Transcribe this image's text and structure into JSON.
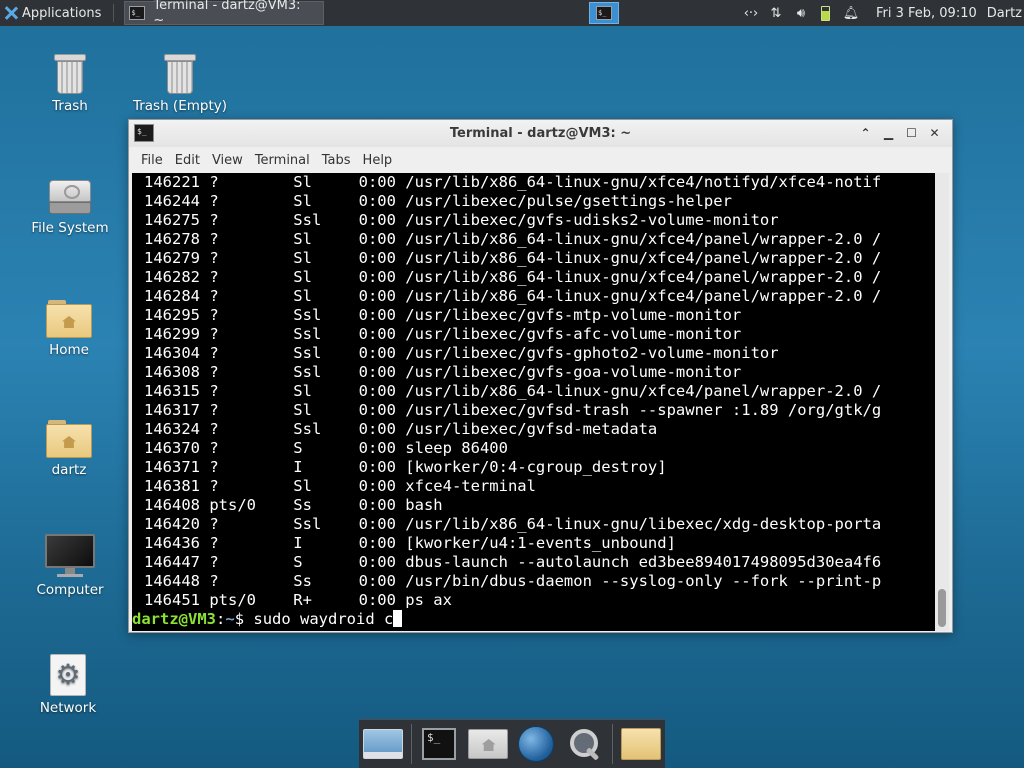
{
  "top_panel": {
    "applications_label": "Applications",
    "task_title": "Terminal - dartz@VM3: ~",
    "clock": "Fri  3 Feb, 09:10",
    "user": "Dartz"
  },
  "desktop_icons": [
    {
      "id": "trash",
      "label": "Trash"
    },
    {
      "id": "trash-empty",
      "label": "Trash (Empty)"
    },
    {
      "id": "file-system",
      "label": "File System"
    },
    {
      "id": "home",
      "label": "Home"
    },
    {
      "id": "dartz",
      "label": "dartz"
    },
    {
      "id": "computer",
      "label": "Computer"
    },
    {
      "id": "network",
      "label": "Network"
    }
  ],
  "window": {
    "title": "Terminal - dartz@VM3: ~",
    "menu": [
      "File",
      "Edit",
      "View",
      "Terminal",
      "Tabs",
      "Help"
    ]
  },
  "terminal": {
    "lines": [
      "146221 ?        Sl     0:00 /usr/lib/x86_64-linux-gnu/xfce4/notifyd/xfce4-notif",
      "146244 ?        Sl     0:00 /usr/libexec/pulse/gsettings-helper",
      "146275 ?        Ssl    0:00 /usr/libexec/gvfs-udisks2-volume-monitor",
      "146278 ?        Sl     0:00 /usr/lib/x86_64-linux-gnu/xfce4/panel/wrapper-2.0 /",
      "146279 ?        Sl     0:00 /usr/lib/x86_64-linux-gnu/xfce4/panel/wrapper-2.0 /",
      "146282 ?        Sl     0:00 /usr/lib/x86_64-linux-gnu/xfce4/panel/wrapper-2.0 /",
      "146284 ?        Sl     0:00 /usr/lib/x86_64-linux-gnu/xfce4/panel/wrapper-2.0 /",
      "146295 ?        Ssl    0:00 /usr/libexec/gvfs-mtp-volume-monitor",
      "146299 ?        Ssl    0:00 /usr/libexec/gvfs-afc-volume-monitor",
      "146304 ?        Ssl    0:00 /usr/libexec/gvfs-gphoto2-volume-monitor",
      "146308 ?        Ssl    0:00 /usr/libexec/gvfs-goa-volume-monitor",
      "146315 ?        Sl     0:00 /usr/lib/x86_64-linux-gnu/xfce4/panel/wrapper-2.0 /",
      "146317 ?        Sl     0:00 /usr/libexec/gvfsd-trash --spawner :1.89 /org/gtk/g",
      "146324 ?        Ssl    0:00 /usr/libexec/gvfsd-metadata",
      "146370 ?        S      0:00 sleep 86400",
      "146371 ?        I      0:00 [kworker/0:4-cgroup_destroy]",
      "146381 ?        Sl     0:00 xfce4-terminal",
      "146408 pts/0    Ss     0:00 bash",
      "146420 ?        Ssl    0:00 /usr/lib/x86_64-linux-gnu/libexec/xdg-desktop-porta",
      "146436 ?        I      0:00 [kworker/u4:1-events_unbound]",
      "146447 ?        S      0:00 dbus-launch --autolaunch ed3bee894017498095d30ea4f6",
      "146448 ?        Ss     0:00 /usr/bin/dbus-daemon --syslog-only --fork --print-p",
      "146451 pts/0    R+     0:00 ps ax"
    ],
    "prompt_user": "dartz@VM3",
    "prompt_sep": ":",
    "prompt_path": "~",
    "prompt_dollar": "$ ",
    "command": "sudo waydroid c"
  }
}
